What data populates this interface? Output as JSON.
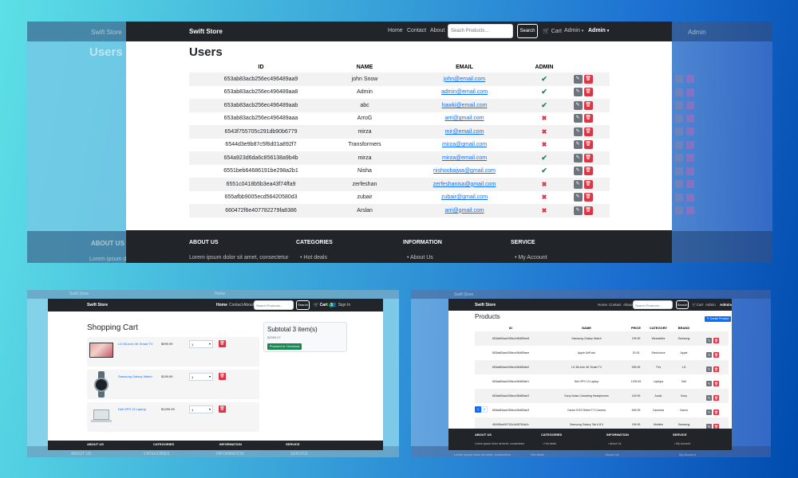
{
  "users_window": {
    "brand": "Swift Store",
    "nav": [
      "Home",
      "Contact",
      "About"
    ],
    "search_placeholder": "Seach Products...",
    "search_button": "Search",
    "cart": "Cart",
    "admin_menu": "Admin",
    "user_menu": "Admin",
    "title": "Users",
    "columns": [
      "ID",
      "NAME",
      "EMAIL",
      "ADMIN"
    ],
    "rows": [
      {
        "id": "653ab83acb256ec496489aa9",
        "name": "john Snow",
        "email": "john@email.com",
        "admin": true
      },
      {
        "id": "653ab83acb256ec496489aa8",
        "name": "Admin",
        "email": "admin@email.com",
        "admin": true
      },
      {
        "id": "653ab83acb256ec496489aab",
        "name": "abc",
        "email": "hawki@email.com",
        "admin": true
      },
      {
        "id": "653ab83acb256ec496489aaa",
        "name": "ArroG",
        "email": "arri@gmail.com",
        "admin": false
      },
      {
        "id": "6543f755705c291db90b6779",
        "name": "mirza",
        "email": "mir@email.com",
        "admin": false
      },
      {
        "id": "6544d3e9b87c5f6d01a892f7",
        "name": "Transformers",
        "email": "mirza@gmail.com",
        "admin": false
      },
      {
        "id": "654a923d6da6c856138a9b4b",
        "name": "mirza",
        "email": "mirza@email.com",
        "admin": true
      },
      {
        "id": "6551beb64686191be298a2b1",
        "name": "Nisha",
        "email": "nishoobajwa@gmail.com",
        "admin": true
      },
      {
        "id": "6551c0418b5b3ea43f74ffa9",
        "name": "zerfeshan",
        "email": "zerfeshanisa@gmail.com",
        "admin": false
      },
      {
        "id": "655afbb9005ecd56420580d3",
        "name": "zubair",
        "email": "zubair@gmail.com",
        "admin": false
      },
      {
        "id": "660472f6e407782279fa8386",
        "name": "Arslan",
        "email": "arri@gmail.com",
        "admin": false
      }
    ],
    "footer": {
      "about_title": "ABOUT US",
      "about_text": "Lorem ipsum dolor sit amet, consectetur",
      "categories_title": "CATEGORIES",
      "categories_item": "Hot deals",
      "information_title": "INFORMATION",
      "information_item": "About Us",
      "service_title": "SERVICE",
      "service_item": "My Account"
    },
    "ghost": {
      "brand": "Swift Store",
      "title": "Users",
      "admin": "Admin",
      "about": "ABOUT US",
      "lorem": "Lorem ipsum d"
    }
  },
  "cart_window": {
    "brand": "Swift Store",
    "nav": [
      "Home",
      "Contact",
      "About"
    ],
    "search_placeholder": "Search Products...",
    "search_button": "Search",
    "cart": "Cart",
    "cart_count": "3",
    "signin": "Sign In",
    "title": "Shopping Cart",
    "items": [
      {
        "name": "LG 55-inch 4K Smart TV",
        "price": "$999.99",
        "qty": "1"
      },
      {
        "name": "Samsung Galaxy Watch",
        "price": "$199.99",
        "qty": "1"
      },
      {
        "name": "Dell XPS 13 Laptop",
        "price": "$1299.99",
        "qty": "1"
      }
    ],
    "subtotal_title": "Subtotal 3 item(s)",
    "subtotal_value": "$2599.97",
    "checkout_button": "Proceed to Checkout",
    "footer": {
      "about_title": "ABOUT US",
      "categories_title": "CATEGORIES",
      "information_title": "INFORMATION",
      "service_title": "SERVICE"
    },
    "ghost": {
      "brand": "Swift Store",
      "nav": "Home",
      "about": "ABOUT US",
      "categories": "CATEGORIES",
      "information": "INFORMATION",
      "service": "SERVICE"
    }
  },
  "products_window": {
    "brand": "Swift Store",
    "nav": [
      "Home",
      "Contact",
      "About"
    ],
    "search_placeholder": "Search Products...",
    "search_button": "Search",
    "cart": "Cart",
    "admin_menu": "Admin",
    "user_menu": "Admin",
    "title": "Products",
    "create_button": "Create Product",
    "columns": [
      "ID",
      "NAME",
      "PRICE",
      "CATEGORY",
      "BRAND"
    ],
    "rows": [
      {
        "id": "653ab83acb256ec496489ee6",
        "name": "Samsung Galaxy Watch",
        "price": "199.99",
        "category": "Wearables",
        "brand": "Samsung"
      },
      {
        "id": "653ab83acb256ec496489aee",
        "name": "Apple AirPods",
        "price": "20.00",
        "category": "Electronics",
        "brand": "Apple"
      },
      {
        "id": "653ab83acb256ec496489ab0",
        "name": "LG 55-inch 4K Smart TV",
        "price": "999.99",
        "category": "TVs",
        "brand": "LG"
      },
      {
        "id": "653ab83acb256ec496489ab1",
        "name": "Dell XPS 13 Laptop",
        "price": "1299.99",
        "category": "Laptops",
        "brand": "Dell"
      },
      {
        "id": "653ab83acb256ec496489ae2",
        "name": "Sony Noise-Canceling Headphones",
        "price": "149.99",
        "category": "Audio",
        "brand": "Sony"
      },
      {
        "id": "653ab83acb256ec496489ab3",
        "name": "Canon EOS Rebel T7i Camera",
        "price": "699.99",
        "category": "Cameras",
        "brand": "Canon"
      },
      {
        "id": "65495ba0f2752c1b08784a2c",
        "name": "Samsung Galaxy Tab A 8.0",
        "price": "199.99",
        "category": "Mobiles",
        "brand": "Samsung"
      },
      {
        "id": "654f0808f37f87dd815942d",
        "name": "Samsung Galaxy Tab A 8.0",
        "price": "39.40",
        "category": "Mobiles",
        "brand": "Samsung"
      }
    ],
    "pages": [
      "1",
      "2"
    ],
    "footer": {
      "about_title": "ABOUT US",
      "about_text": "Lorem ipsum dolor sit amet, consectetur",
      "categories_title": "CATEGORIES",
      "categories_item": "Hot deals",
      "information_title": "INFORMATION",
      "information_item": "About Us",
      "service_title": "SERVICE",
      "service_item": "My Account"
    },
    "ghost": {
      "brand": "Swift Store",
      "lorem": "Lorem ipsum dolor sit amet, consectetur",
      "hot": "Hot deals",
      "about": "About Us",
      "account": "My Account"
    }
  }
}
